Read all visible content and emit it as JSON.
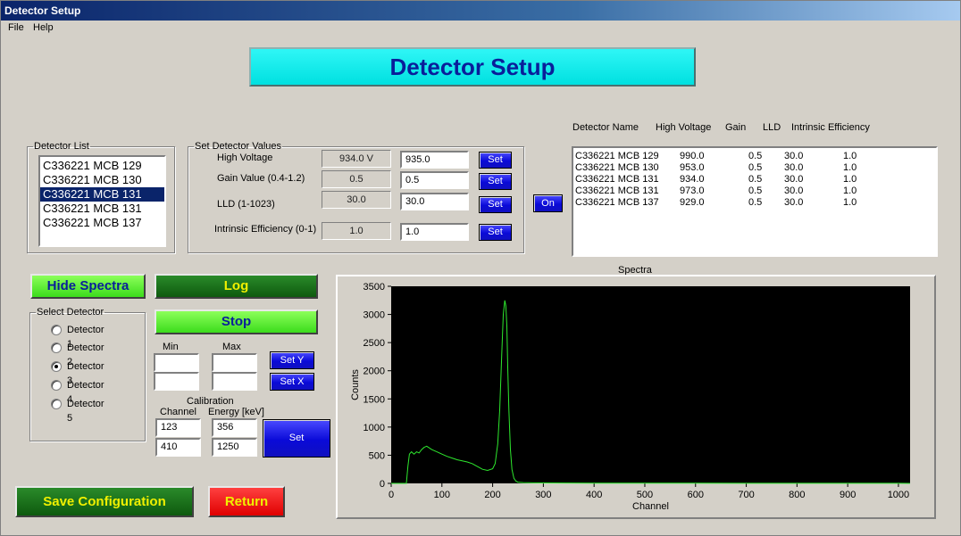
{
  "window": {
    "title": "Detector Setup"
  },
  "menu": [
    {
      "label": "File"
    },
    {
      "label": "Help"
    }
  ],
  "banner": "Detector Setup",
  "detector_list": {
    "legend": "Detector List",
    "items": [
      "C336221 MCB 129",
      "C336221 MCB 130",
      "C336221 MCB 131",
      "C336221 MCB 131",
      "C336221 MCB 137"
    ],
    "selected_index": 2
  },
  "set_values": {
    "legend": "Set Detector Values",
    "rows": [
      {
        "label": "High Voltage",
        "current": "934.0 V",
        "input": "935.0",
        "button": "Set"
      },
      {
        "label": "Gain Value (0.4-1.2)",
        "current": "0.5",
        "input": "0.5",
        "button": "Set"
      },
      {
        "label": "LLD (1-1023)",
        "current": "30.0",
        "input": "30.0",
        "button": "Set"
      },
      {
        "label": "Intrinsic Efficiency (0-1)",
        "current": "1.0",
        "input": "1.0",
        "button": "Set"
      }
    ]
  },
  "on_button": "On",
  "detector_table": {
    "headers": [
      "Detector Name",
      "High Voltage",
      "Gain",
      "LLD",
      "Intrinsic Efficiency"
    ],
    "rows": [
      [
        "C336221 MCB 129",
        "990.0",
        "0.5",
        "30.0",
        "1.0"
      ],
      [
        "C336221 MCB 130",
        "953.0",
        "0.5",
        "30.0",
        "1.0"
      ],
      [
        "C336221 MCB 131",
        "934.0",
        "0.5",
        "30.0",
        "1.0"
      ],
      [
        "C336221 MCB 131",
        "973.0",
        "0.5",
        "30.0",
        "1.0"
      ],
      [
        "C336221 MCB 137",
        "929.0",
        "0.5",
        "30.0",
        "1.0"
      ]
    ]
  },
  "buttons": {
    "hide_spectra": "Hide Spectra",
    "log": "Log",
    "stop": "Stop",
    "set_y": "Set Y",
    "set_x": "Set X",
    "cal_set": "Set",
    "save": "Save Configuration",
    "return": "Return"
  },
  "select_detector": {
    "legend": "Select Detector",
    "options": [
      "Detector 1",
      "Detector 2",
      "Detector 3",
      "Detector 4",
      "Detector 5"
    ],
    "selected_index": 2
  },
  "range": {
    "min_label": "Min",
    "max_label": "Max",
    "min_y": "",
    "max_y": "",
    "min_x": "",
    "max_x": ""
  },
  "calibration": {
    "title": "Calibration",
    "channel_label": "Channel",
    "energy_label": "Energy [keV]",
    "points": [
      {
        "channel": "123",
        "energy": "356"
      },
      {
        "channel": "410",
        "energy": "1250"
      }
    ]
  },
  "chart_data": {
    "type": "line",
    "title": "Spectra",
    "xlabel": "Channel",
    "ylabel": "Counts",
    "xlim": [
      0,
      1023
    ],
    "ylim": [
      0,
      3500
    ],
    "xticks": [
      0,
      100,
      200,
      300,
      400,
      500,
      600,
      700,
      800,
      900,
      1000
    ],
    "yticks": [
      0,
      500,
      1000,
      1500,
      2000,
      2500,
      3000,
      3500
    ],
    "background": "#000000",
    "line_color": "#2ee82e",
    "series": [
      {
        "x": [
          0,
          30,
          33,
          36,
          40,
          45,
          50,
          55,
          60,
          65,
          70,
          75,
          80,
          90,
          100,
          110,
          120,
          130,
          140,
          150,
          160,
          170,
          180,
          190,
          200,
          205,
          210,
          214,
          218,
          221,
          224,
          226,
          228,
          230,
          232,
          235,
          238,
          242,
          246,
          250,
          260,
          280,
          300,
          350,
          400,
          500,
          600,
          700,
          800,
          900,
          1000,
          1023
        ],
        "y": [
          0,
          0,
          300,
          520,
          560,
          520,
          560,
          540,
          600,
          640,
          660,
          630,
          600,
          560,
          520,
          480,
          450,
          420,
          400,
          380,
          350,
          300,
          250,
          230,
          260,
          350,
          700,
          1300,
          2300,
          3000,
          3250,
          3150,
          2800,
          2000,
          1300,
          600,
          250,
          90,
          40,
          20,
          15,
          10,
          8,
          6,
          5,
          4,
          3,
          2,
          2,
          1,
          1,
          0
        ]
      }
    ]
  }
}
